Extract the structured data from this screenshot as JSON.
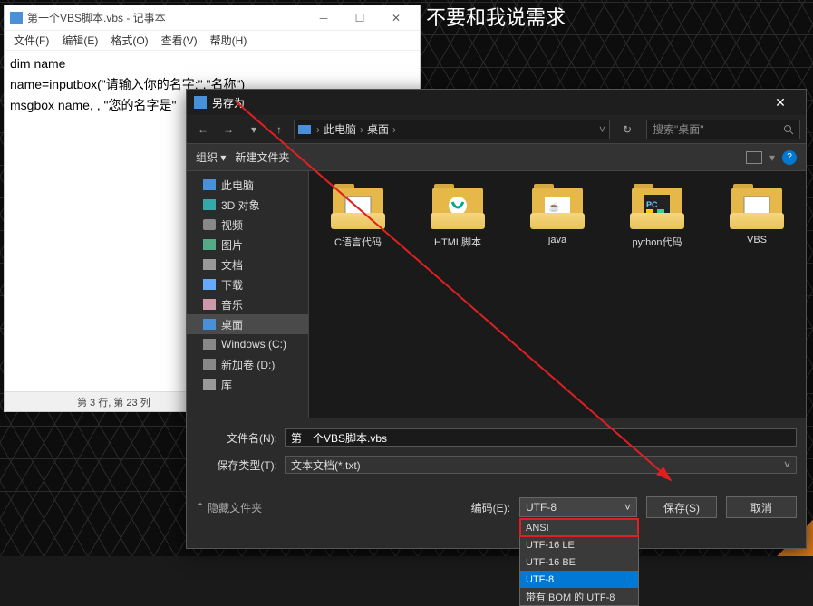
{
  "top_overlay_text": "不要和我说需求",
  "notepad": {
    "title": "第一个VBS脚本.vbs - 记事本",
    "menu": [
      "文件(F)",
      "编辑(E)",
      "格式(O)",
      "查看(V)",
      "帮助(H)"
    ],
    "code_line1": "dim name",
    "code_line2": "name=inputbox(\"请输入你的名字:\",\"名称\")",
    "code_line3": "msgbox name, , \"您的名字是\"",
    "status": "第 3 行, 第 23 列"
  },
  "dialog": {
    "title": "另存为",
    "nav": {
      "back": "←",
      "fwd": "→",
      "up": "↑",
      "path_pc": "此电脑",
      "path_desktop": "桌面",
      "refresh": "↻",
      "search_placeholder": "搜索\"桌面\""
    },
    "toolbar": {
      "organize": "组织",
      "new_folder": "新建文件夹",
      "help": "?"
    },
    "sidebar": {
      "items": [
        {
          "label": "此电脑",
          "icon": "pc"
        },
        {
          "label": "3D 对象",
          "icon": "cube"
        },
        {
          "label": "视频",
          "icon": "vid"
        },
        {
          "label": "图片",
          "icon": "img"
        },
        {
          "label": "文档",
          "icon": "doc"
        },
        {
          "label": "下载",
          "icon": "dl"
        },
        {
          "label": "音乐",
          "icon": "music"
        },
        {
          "label": "桌面",
          "icon": "desk",
          "selected": true
        },
        {
          "label": "Windows (C:)",
          "icon": "drive"
        },
        {
          "label": "新加卷 (D:)",
          "icon": "drive"
        },
        {
          "label": "库",
          "icon": "doc"
        }
      ]
    },
    "folders": [
      {
        "label": "C语言代码"
      },
      {
        "label": "HTML脚本"
      },
      {
        "label": "java"
      },
      {
        "label": "python代码"
      },
      {
        "label": "VBS"
      }
    ],
    "filename_label": "文件名(N):",
    "filename_value": "第一个VBS脚本.vbs",
    "filetype_label": "保存类型(T):",
    "filetype_value": "文本文档(*.txt)",
    "hide_folders": "隐藏文件夹",
    "encoding_label": "编码(E):",
    "encoding_value": "UTF-8",
    "encoding_options": [
      "ANSI",
      "UTF-16 LE",
      "UTF-16 BE",
      "UTF-8",
      "带有 BOM 的 UTF-8"
    ],
    "save_btn": "保存(S)",
    "cancel_btn": "取消"
  }
}
